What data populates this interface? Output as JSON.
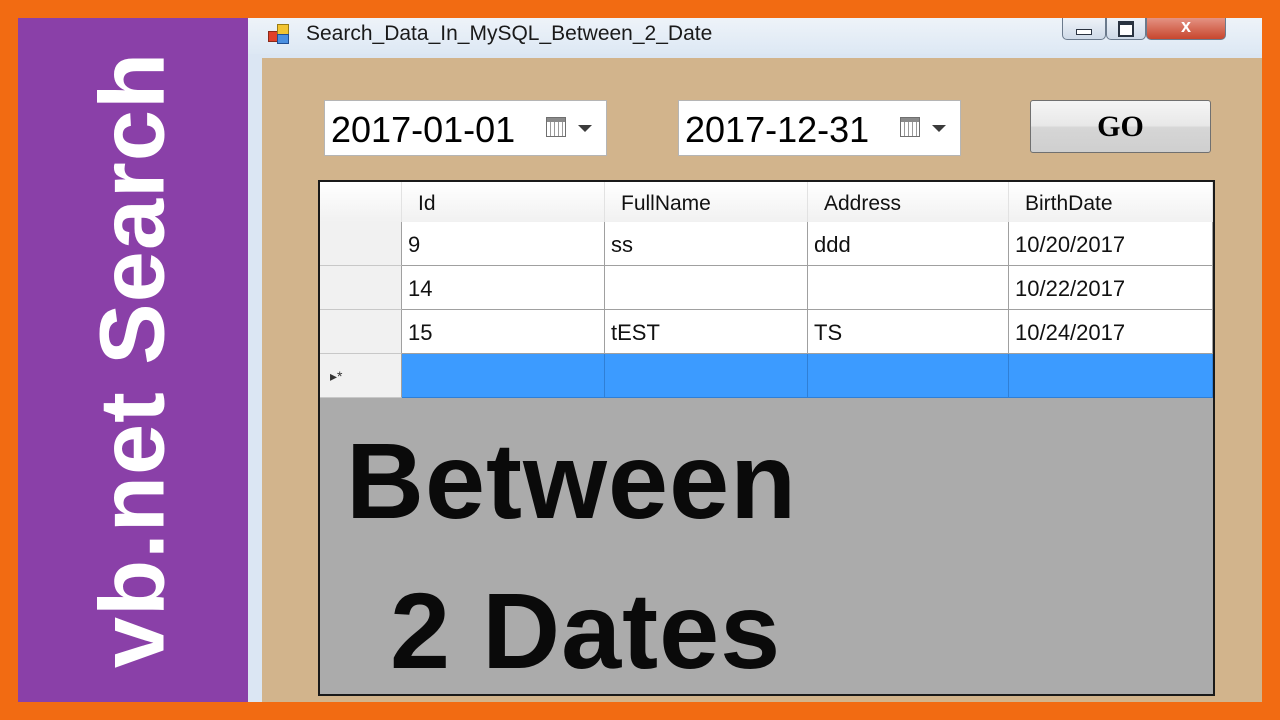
{
  "banner": {
    "side_text": "vb.net Search",
    "overlay_line1": "Between",
    "overlay_line2": "2 Dates"
  },
  "window": {
    "title": "Search_Data_In_MySQL_Between_2_Date",
    "controls": {
      "minimize": "",
      "maximize": "",
      "close": "x"
    }
  },
  "form": {
    "start_date": "2017-01-01",
    "end_date": "2017-12-31",
    "go_label": "GO"
  },
  "grid": {
    "columns": [
      "Id",
      "FullName",
      "Address",
      "BirthDate"
    ],
    "rows": [
      [
        "9",
        "ss",
        "ddd",
        "10/20/2017"
      ],
      [
        "14",
        "",
        "",
        "10/22/2017"
      ],
      [
        "15",
        "tEST",
        "TS",
        "10/24/2017"
      ]
    ],
    "new_row_marker": "▸*"
  },
  "colors": {
    "frame": "#f26b12",
    "sidebar": "#8a40a8",
    "form_background": "#d2b48c",
    "selected_row": "#3c9bff"
  }
}
